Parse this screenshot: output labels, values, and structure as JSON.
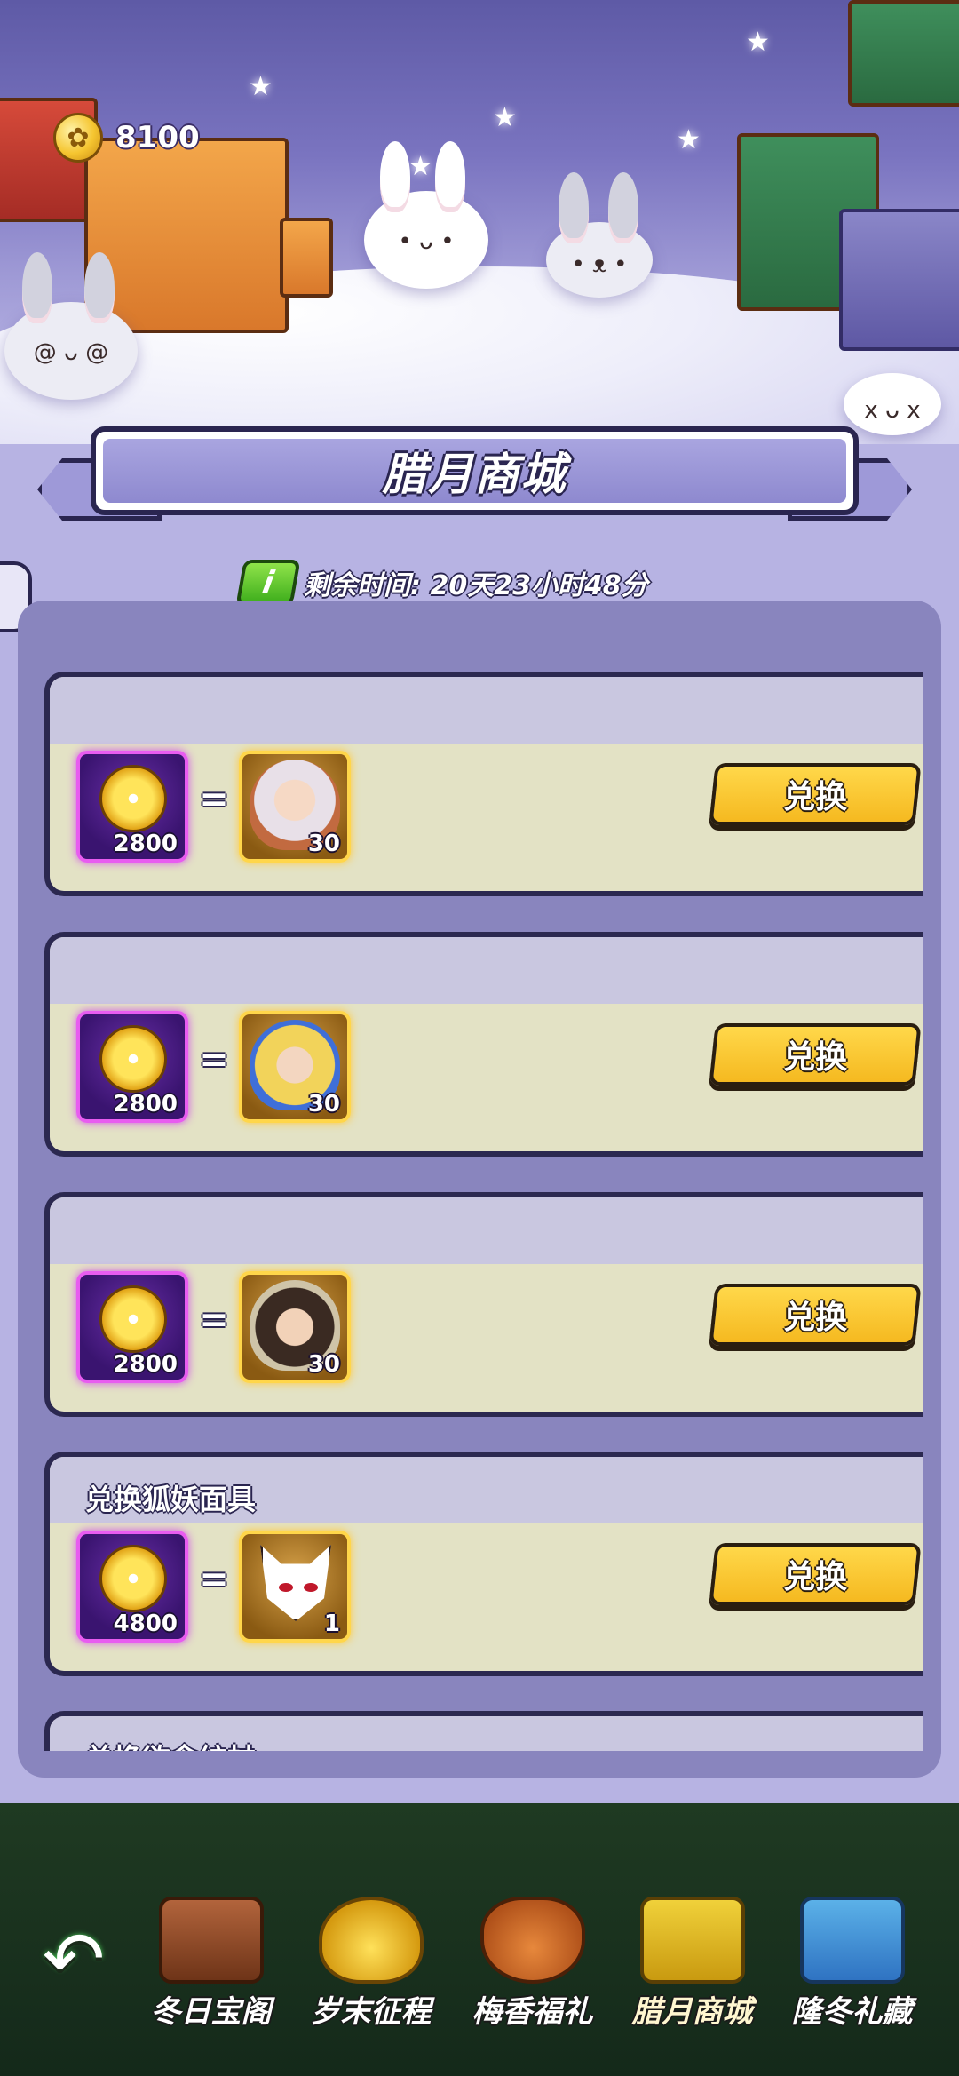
{
  "currency": {
    "icon": "plum-flower-coin-icon",
    "amount": "8100"
  },
  "banner": {
    "title": "腊月商城"
  },
  "timer": {
    "info_icon": "i",
    "text": "剩余时间: 20天23小时48分"
  },
  "items": [
    {
      "title": "",
      "cost": "2800",
      "reward_type": "hero-fragment-portrait-1",
      "reward_count": "30",
      "button": "兑换"
    },
    {
      "title": "",
      "cost": "2800",
      "reward_type": "hero-fragment-portrait-2",
      "reward_count": "30",
      "button": "兑换"
    },
    {
      "title": "",
      "cost": "2800",
      "reward_type": "hero-fragment-portrait-3",
      "reward_count": "30",
      "button": "兑换"
    },
    {
      "title": "兑换狐妖面具",
      "cost": "4800",
      "reward_type": "fox-mask",
      "reward_count": "1",
      "button": "兑换"
    },
    {
      "title": "兑换欲念纺杖",
      "cost": "",
      "reward_type": "",
      "reward_count": "",
      "button": ""
    }
  ],
  "equals_sign": "=",
  "nav": {
    "back_icon": "back-arrow-icon",
    "tabs": [
      {
        "label": "冬日宝阁",
        "icon": "treasure-chest-icon",
        "active": false
      },
      {
        "label": "岁末征程",
        "icon": "gold-ingot-icon",
        "active": false
      },
      {
        "label": "梅香福礼",
        "icon": "lucky-bag-icon",
        "active": false
      },
      {
        "label": "腊月商城",
        "icon": "shop-chest-icon",
        "active": true
      },
      {
        "label": "隆冬礼藏",
        "icon": "gift-box-icon",
        "active": false
      }
    ]
  },
  "colors": {
    "panel_bg": "#8985be",
    "card_body": "#e3e2c5",
    "button_yellow": "#ffd84a",
    "nav_bg": "#1f3a22",
    "cost_border": "#e85cf0",
    "reward_border": "#ffd64a"
  }
}
